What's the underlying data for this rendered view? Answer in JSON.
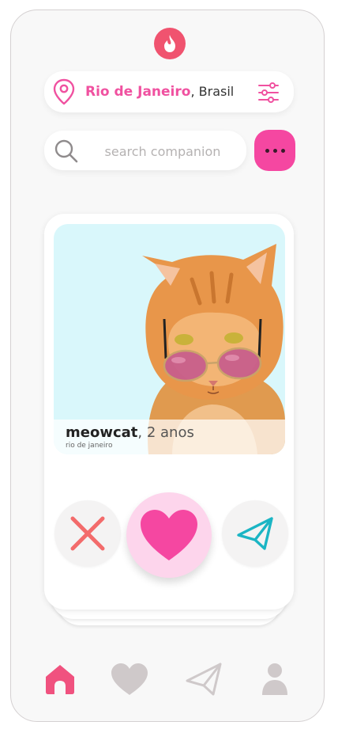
{
  "header": {
    "logo_icon": "flame-icon",
    "accent": "#f0536f"
  },
  "location": {
    "icon": "map-pin-icon",
    "city": "Rio de Janeiro",
    "separator": ",",
    "country": " Brasil",
    "filter_icon": "sliders-icon"
  },
  "search": {
    "placeholder": "search companion",
    "value": "",
    "icon": "search-icon"
  },
  "more_button": {
    "icon": "more-dots-icon",
    "color": "#f547a1"
  },
  "profile": {
    "name": "meowcat",
    "age_text": ", 2 anos",
    "city": "rio de janeiro",
    "photo": "orange-cat-with-sunglasses"
  },
  "actions": {
    "reject_icon": "close-icon",
    "like_icon": "heart-icon",
    "send_icon": "paper-plane-icon",
    "colors": {
      "reject": "#f36b6b",
      "like": "#f547a1",
      "send": "#1bb5c4"
    }
  },
  "nav": [
    {
      "id": "home",
      "icon": "home-icon",
      "active": true
    },
    {
      "id": "favorites",
      "icon": "heart-icon",
      "active": false
    },
    {
      "id": "messages",
      "icon": "paper-plane-icon",
      "active": false
    },
    {
      "id": "profile",
      "icon": "user-icon",
      "active": false
    }
  ]
}
